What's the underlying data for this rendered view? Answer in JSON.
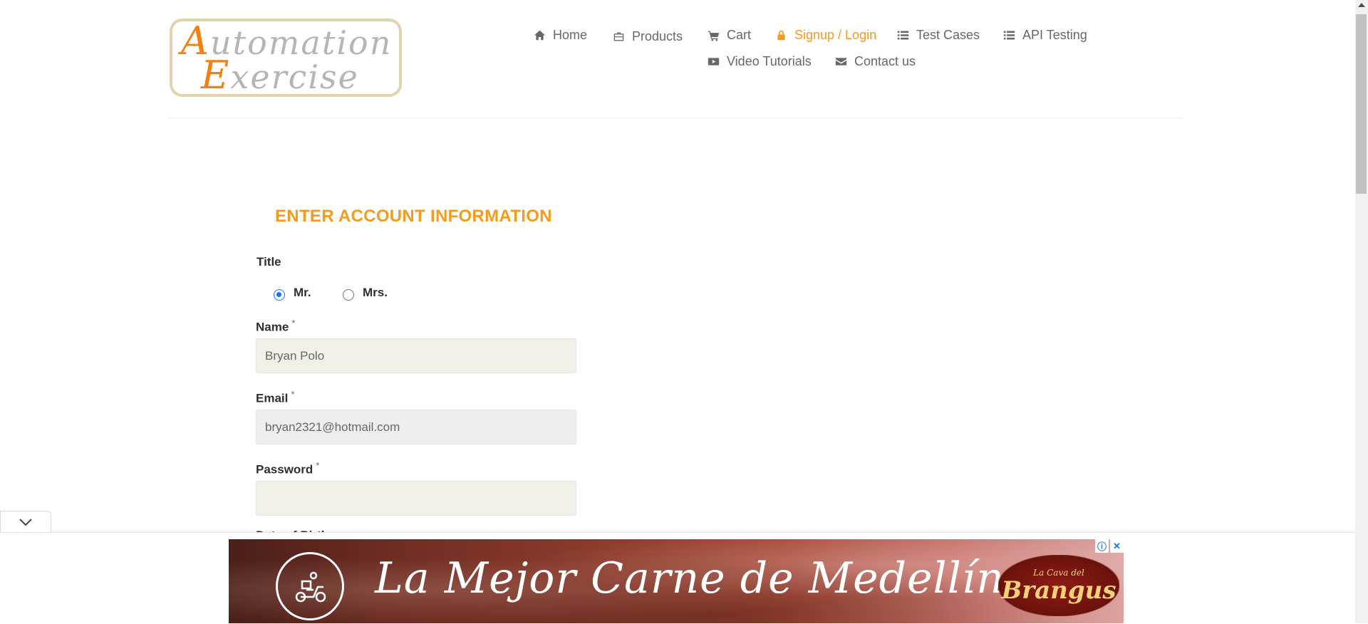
{
  "logo": {
    "line1_first": "A",
    "line1_rest": "utomation",
    "line2_first": "E",
    "line2_rest": "xercise"
  },
  "nav": {
    "home": "Home",
    "products": "Products",
    "cart": "Cart",
    "signup_login": "Signup / Login",
    "test_cases": "Test Cases",
    "api_testing": "API Testing",
    "video_tutorials": "Video Tutorials",
    "contact_us": "Contact us"
  },
  "form": {
    "heading": "ENTER ACCOUNT INFORMATION",
    "title_label": "Title",
    "title_options": [
      "Mr.",
      "Mrs."
    ],
    "title_selected": "Mr.",
    "name_label": "Name",
    "name_value": "Bryan Polo",
    "email_label": "Email",
    "email_value": "bryan2321@hotmail.com",
    "password_label": "Password",
    "password_value": "",
    "required_mark": "*",
    "next_label_partial": "Date of Birth"
  },
  "ad": {
    "headline": "La Mejor Carne de Medellín",
    "brand_small": "La Cava del",
    "brand_big": "Brangus",
    "info_glyph": "ⓘ",
    "close_glyph": "✕"
  },
  "colors": {
    "accent": "#f49b1c",
    "logo_orange": "#f57f10",
    "input_bg": "#f0f0e9",
    "radio_blue": "#1a73e8"
  },
  "icons": [
    "home-icon",
    "briefcase-icon",
    "cart-icon",
    "lock-icon",
    "list-icon",
    "list-icon",
    "youtube-play-icon",
    "envelope-icon",
    "scooter-icon",
    "chevron-down-icon",
    "info-icon",
    "close-icon"
  ]
}
